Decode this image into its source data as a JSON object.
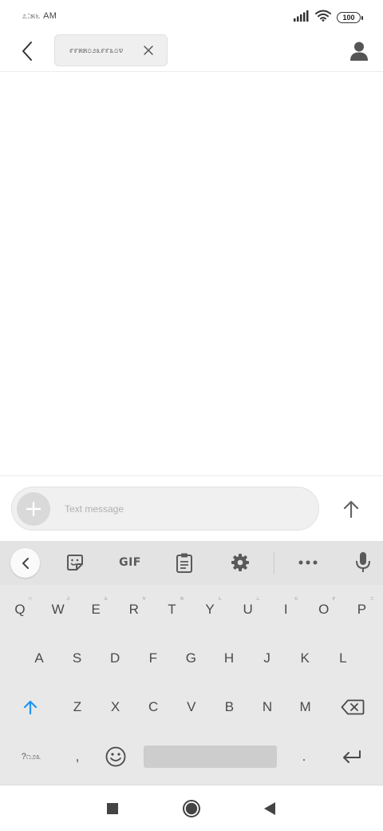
{
  "status_bar": {
    "time": "೭:೫೬ AM",
    "battery": "100",
    "icons": [
      "signal-icon",
      "wifi-icon",
      "battery-icon"
    ]
  },
  "app_bar": {
    "recipient": "೯೯೫೫೦೨೩೯೯೩೦೪",
    "icons": [
      "back-arrow-icon",
      "close-icon",
      "person-icon"
    ]
  },
  "compose": {
    "placeholder": "Text message",
    "icons": [
      "plus-icon",
      "send-arrow-icon"
    ]
  },
  "keyboard": {
    "toolbar": {
      "gif_label": "GIF",
      "icons": [
        "chevron-left-icon",
        "sticker-icon",
        "clipboard-icon",
        "settings-icon",
        "more-icon",
        "mic-icon"
      ]
    },
    "row1": [
      {
        "label": "Q",
        "hint": "೧"
      },
      {
        "label": "W",
        "hint": "೨"
      },
      {
        "label": "E",
        "hint": "೩"
      },
      {
        "label": "R",
        "hint": "೪"
      },
      {
        "label": "T",
        "hint": "೫"
      },
      {
        "label": "Y",
        "hint": "೬"
      },
      {
        "label": "U",
        "hint": "೭"
      },
      {
        "label": "I",
        "hint": "೮"
      },
      {
        "label": "O",
        "hint": "೯"
      },
      {
        "label": "P",
        "hint": "೦"
      }
    ],
    "row2": [
      "A",
      "S",
      "D",
      "F",
      "G",
      "H",
      "J",
      "K",
      "L"
    ],
    "row3": [
      "Z",
      "X",
      "C",
      "V",
      "B",
      "N",
      "M"
    ],
    "bottom": {
      "symbols_label": "?೧೨೩",
      "comma": ",",
      "period": "."
    },
    "accent_color": "#2196F3"
  },
  "nav_bar": {
    "icons": [
      "recents-square-icon",
      "home-circle-icon",
      "back-triangle-icon"
    ]
  }
}
